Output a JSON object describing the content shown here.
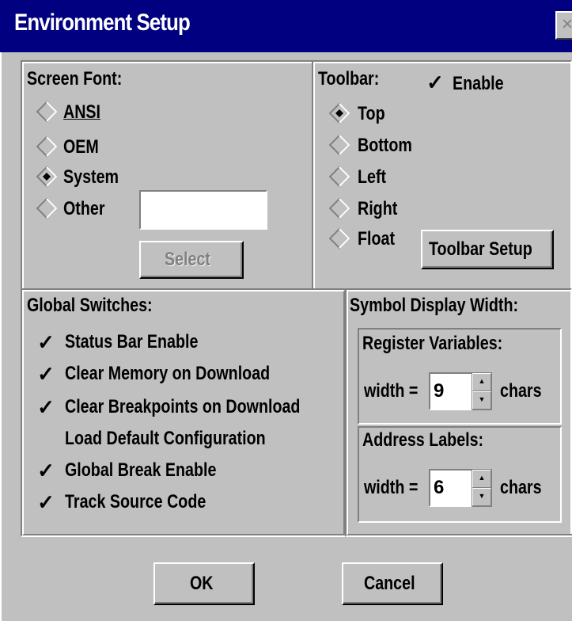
{
  "window": {
    "title": "Environment Setup",
    "close_glyph": "×"
  },
  "screen_font": {
    "label": "Screen Font:",
    "options": [
      {
        "label": "ANSI",
        "selected": false
      },
      {
        "label": "OEM",
        "selected": false
      },
      {
        "label": "System",
        "selected": true
      },
      {
        "label": "Other",
        "selected": false
      }
    ],
    "other_value": "",
    "select_button": "Select"
  },
  "toolbar": {
    "label": "Toolbar:",
    "enable_label": "Enable",
    "enable_checked": true,
    "options": [
      {
        "label": "Top",
        "selected": true
      },
      {
        "label": "Bottom",
        "selected": false
      },
      {
        "label": "Left",
        "selected": false
      },
      {
        "label": "Right",
        "selected": false
      },
      {
        "label": "Float",
        "selected": false
      }
    ],
    "setup_button": "Toolbar Setup"
  },
  "global_switches": {
    "label": "Global Switches:",
    "items": [
      {
        "label": "Status Bar Enable",
        "checked": true
      },
      {
        "label": "Clear Memory on Download",
        "checked": true
      },
      {
        "label": "Clear Breakpoints on Download",
        "checked": true
      },
      {
        "label": "Load Default Configuration",
        "checked": false
      },
      {
        "label": "Global Break Enable",
        "checked": true
      },
      {
        "label": "Track Source Code",
        "checked": true
      }
    ]
  },
  "symbol_width": {
    "label": "Symbol Display Width:",
    "register": {
      "label": "Register Variables:",
      "prefix": "width =",
      "value": "9",
      "suffix": "chars"
    },
    "address": {
      "label": "Address Labels:",
      "prefix": "width =",
      "value": "6",
      "suffix": "chars"
    }
  },
  "buttons": {
    "ok": "OK",
    "cancel": "Cancel"
  },
  "check_glyph": "✓"
}
